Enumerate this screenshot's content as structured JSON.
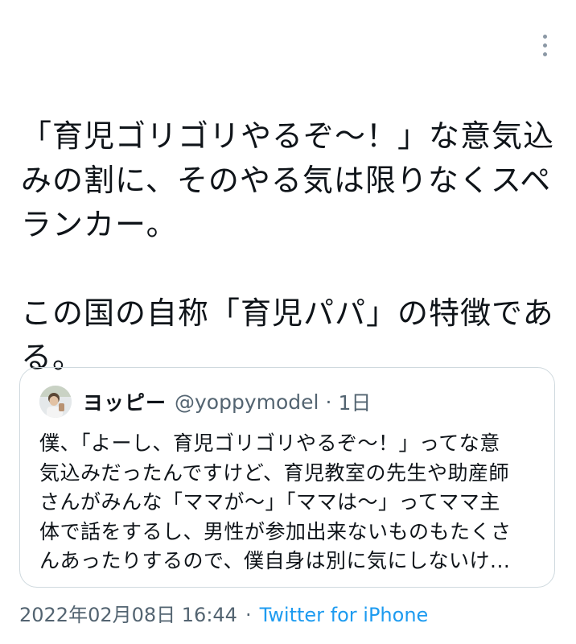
{
  "tweet": {
    "paragraph1": "「育児ゴリゴリやるぞ〜！」な意気込\nみの割に、そのやる気は限りなくスペ\nランカー。",
    "paragraph2": "この国の自称「育児パパ」の特徴であ\nる。"
  },
  "quote": {
    "name": "ヨッピー",
    "handle": "@yoppymodel",
    "separator": "·",
    "time": "1日",
    "text": "僕、「よーし、育児ゴリゴリやるぞ〜！」ってな意\n気込みだったんですけど、育児教室の先生や助産師\nさんがみんな「ママが〜」「ママは〜」ってママ主\n体で話をするし、男性が参加出来ないものもたくさ\nんあったりするので、僕自身は別に気にしないけ..."
  },
  "meta": {
    "datetime": "2022年02月08日 16:44",
    "separator": "·",
    "source": "Twitter for iPhone"
  },
  "colors": {
    "text": "#0f1419",
    "secondary": "#536471",
    "link": "#1d9bf0",
    "border": "#cfd9de"
  },
  "icons": {
    "more": "more-vertical-icon"
  }
}
